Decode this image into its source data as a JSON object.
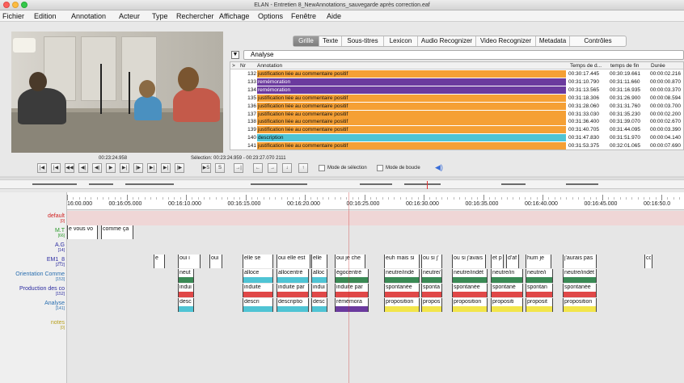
{
  "window": {
    "title": "ELAN - Entretien 8_NewAnnotations_sauvegarde après correction.eaf"
  },
  "menu": [
    "Fichier",
    "Edition",
    "Annotation",
    "Acteur",
    "Type",
    "Rechercher",
    "Affichage",
    "Options",
    "Fenêtre",
    "Aide"
  ],
  "tabs": [
    {
      "label": "Grille",
      "active": true
    },
    {
      "label": "Texte"
    },
    {
      "label": "Sous-titres"
    },
    {
      "label": "Lexicon"
    },
    {
      "label": "Audio Recognizer"
    },
    {
      "label": "Video Recognizer"
    },
    {
      "label": "Metadata"
    },
    {
      "label": "Contrôles"
    }
  ],
  "grid": {
    "tier": "Analyse",
    "columns": {
      "marker": ">",
      "nr": "Nr",
      "annotation": "Annotation",
      "begin": "Temps de d...",
      "end": "temps de fin",
      "duration": "Durée"
    },
    "rows": [
      {
        "nr": "132",
        "text": "justification liée au commentaire positif",
        "begin": "00:30:17.445",
        "end": "00:30:19.661",
        "dur": "00:00:02.216",
        "color": "#f5a035"
      },
      {
        "nr": "133",
        "text": "remémoration",
        "begin": "00:31:10.790",
        "end": "00:31:11.660",
        "dur": "00:00:00.870",
        "color": "#6b3a9e"
      },
      {
        "nr": "134",
        "text": "remémoration",
        "begin": "00:31:13.565",
        "end": "00:31:16.935",
        "dur": "00:00:03.370",
        "color": "#6b3a9e"
      },
      {
        "nr": "135",
        "text": "justification liée au commentaire positif",
        "begin": "00:31:18.306",
        "end": "00:31:26.900",
        "dur": "00:00:08.594",
        "color": "#f5a035"
      },
      {
        "nr": "136",
        "text": "justification liée au commentaire positif",
        "begin": "00:31:28.060",
        "end": "00:31:31.760",
        "dur": "00:00:03.700",
        "color": "#f5a035"
      },
      {
        "nr": "137",
        "text": "justification liée au commentaire positif",
        "begin": "00:31:33.030",
        "end": "00:31:35.230",
        "dur": "00:00:02.200",
        "color": "#f5a035"
      },
      {
        "nr": "138",
        "text": "justification liée au commentaire positif",
        "begin": "00:31:36.400",
        "end": "00:31:39.070",
        "dur": "00:00:02.670",
        "color": "#f5a035"
      },
      {
        "nr": "139",
        "text": "justification liée au commentaire positif",
        "begin": "00:31:40.705",
        "end": "00:31:44.095",
        "dur": "00:00:03.390",
        "color": "#f5a035"
      },
      {
        "nr": "140",
        "text": "description",
        "begin": "00:31:47.830",
        "end": "00:31:51.970",
        "dur": "00:00:04.140",
        "color": "#4fc4d4"
      },
      {
        "nr": "141",
        "text": "justification liée au commentaire positif",
        "begin": "00:31:53.375",
        "end": "00:32:01.065",
        "dur": "00:00:07.690",
        "color": "#f5a035"
      }
    ]
  },
  "player": {
    "current_time": "00:23:24.958",
    "selection": "Sélection: 00:23:24.959 - 00:23:27.070  2111",
    "buttons": [
      "|◀",
      "|◀",
      "◀◀",
      "◀|",
      "◀|",
      "▶",
      "▶|",
      "|▶",
      "▶|",
      "▶|",
      "|▶",
      "▶S",
      "S",
      "→|",
      "←",
      "→",
      "↓",
      "↑"
    ],
    "selection_mode": "Mode de sélection",
    "loop_mode": "Mode de boucle"
  },
  "ruler": [
    "16:00.000",
    "00:16:05.000",
    "00:16:10.000",
    "00:16:15.000",
    "00:16:20.000",
    "00:16:25.000",
    "00:16:30.000",
    "00:16:35.000",
    "00:16:40.000",
    "00:16:45.000",
    "00:16:50.0"
  ],
  "tiers": [
    {
      "name": "default",
      "count": "[0]",
      "color": "#d02020"
    },
    {
      "name": "M.T",
      "count": "[66]",
      "color": "#2a9a2a"
    },
    {
      "name": "A.G",
      "count": "[14]",
      "color": "#2a2aa0"
    },
    {
      "name": "EM1_8",
      "count": "[272]",
      "color": "#2a2aa0"
    },
    {
      "name": "Orientation Comme",
      "count": "[153]",
      "color": "#2a6fb0"
    },
    {
      "name": "Production des co",
      "count": "[152]",
      "color": "#2a2aa0"
    },
    {
      "name": "Analyse",
      "count": "[141]",
      "color": "#2a6fb0"
    },
    {
      "name": "notes",
      "count": "[0]",
      "color": "#b8a020"
    }
  ],
  "annotations": {
    "mt": [
      "e vous vo",
      "comme ça"
    ],
    "em": [
      "e",
      "oui i",
      "oui",
      "elle se",
      "oui elle est",
      "elle",
      "oui je che",
      "euh mais si",
      "ou si j'",
      "ou si j'avais",
      "et p",
      "d'af",
      "hum je",
      "j'aurais pas",
      "co"
    ],
    "orientation": [
      "neut",
      "alloce",
      "allocentré",
      "alloc",
      "égocentré",
      "neutre/indé",
      "neutre/",
      "neutre/indét",
      "neutre/in",
      "neutre/i",
      "neutre/indét"
    ],
    "production": [
      "indui",
      "induite",
      "induite par",
      "indui",
      "induite par",
      "spontanée",
      "sponta",
      "spontanée",
      "spontané",
      "spontan",
      "spontanée"
    ],
    "analyse": [
      "desc",
      "descri",
      "descriptio",
      "desc",
      "rémémora",
      "proposition",
      "propos",
      "proposition",
      "propositi",
      "proposit",
      "proposition"
    ]
  },
  "colors": {
    "orange": "#f5a035",
    "purple": "#6b3a9e",
    "cyan": "#4fc4d4",
    "green": "#3a8a55",
    "red": "#e04848",
    "yellow": "#f2e54a",
    "pink_default": "#efd6d6"
  }
}
